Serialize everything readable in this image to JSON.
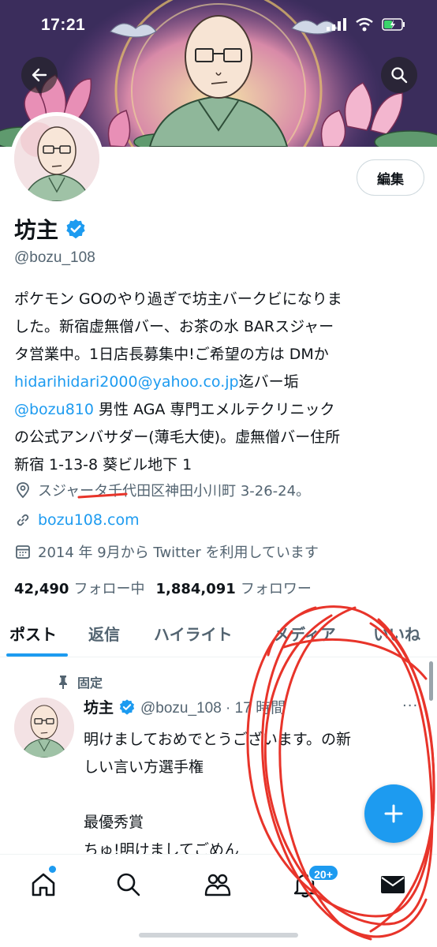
{
  "status_bar": {
    "time": "17:21"
  },
  "profile": {
    "name": "坊主",
    "handle": "@bozu_108",
    "edit_label": "編集",
    "bio": {
      "line1": "ポケモン GOのやり過ぎで坊主バークビになりま",
      "line2": "した。新宿虚無僧バー、お茶の水 BARスジャー",
      "line3": "タ営業中。1日店長募集中!ご希望の方は DMか",
      "email": "hidarihidari2000@yahoo.co.jp",
      "line4_tail": "迄バー垢",
      "mention": "@bozu810",
      "line5_tail": " 男性 AGA 専門エメルテクリニック",
      "line6": "の公式アンバサダー(薄毛大使)。虚無僧バー住所",
      "line7": "新宿 1-13-8 葵ビル地下 1"
    },
    "location": "スジャータ千代田区神田小川町 3-26-24。",
    "website": "bozu108.com",
    "joined": "2014 年 9月から Twitter を利用しています",
    "following_count": "42,490",
    "following_label": "フォロー中",
    "followers_count": "1,884,091",
    "followers_label": "フォロワー"
  },
  "tabs": [
    "ポスト",
    "返信",
    "ハイライト",
    "メディア",
    "いいね"
  ],
  "post": {
    "pinned_label": "固定",
    "name": "坊主",
    "handle_time": "@bozu_108 · 17 時間",
    "more": "···",
    "text": "明けましておめでとうございます。の新\nしい言い方選手権\n\n最優秀賞\nちゅ!明けましてごめん"
  },
  "bottom_nav": {
    "notification_badge": "20+"
  },
  "colors": {
    "accent": "#1d9bf0",
    "text": "#0f1419",
    "muted": "#536471",
    "scribble": "#e8342a"
  }
}
